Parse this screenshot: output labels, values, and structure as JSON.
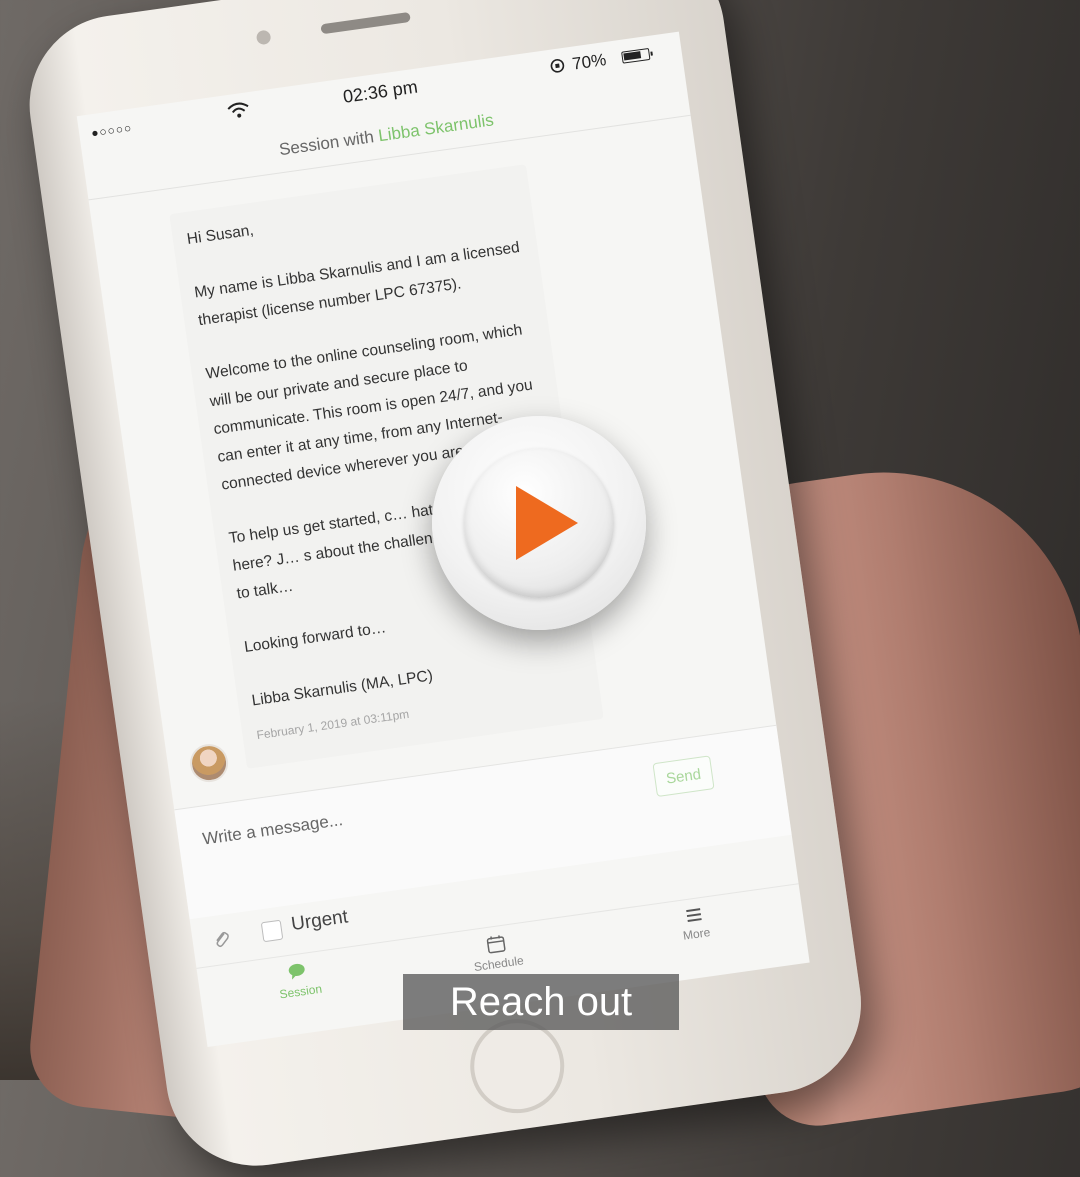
{
  "status_bar": {
    "signal": "●○○○○",
    "time": "02:36 pm",
    "battery": "70%"
  },
  "header": {
    "prefix": "Session with",
    "therapist_name": "Libba Skarnulis"
  },
  "message": {
    "greeting": "Hi Susan,",
    "paragraph_1": "My name is Libba Skarnulis and I am a licensed therapist (license number LPC 67375).",
    "paragraph_2": "Welcome to the online counseling room, which will be our private and secure place to communicate. This room is open 24/7, and you can enter it at any time, from any Internet-connected device wherever you are.",
    "paragraph_3": "To help us get started, c… hat brought you here? J… s about the challeng… ou would like to talk…",
    "closing": "Looking forward to…",
    "signature": "Libba Skarnulis (MA, LPC)",
    "timestamp": "February 1, 2019 at 03:11pm"
  },
  "composer": {
    "placeholder": "Write a message...",
    "send_label": "Send",
    "urgent_label": "Urgent"
  },
  "tabs": [
    {
      "label": "Session",
      "icon": "chat-icon",
      "active": true
    },
    {
      "label": "Schedule",
      "icon": "calendar-icon",
      "active": false
    },
    {
      "label": "More",
      "icon": "menu-icon",
      "active": false
    }
  ],
  "caption": "Reach out",
  "colors": {
    "accent_green": "#7dc36b",
    "play_orange": "#ee6a1f"
  }
}
